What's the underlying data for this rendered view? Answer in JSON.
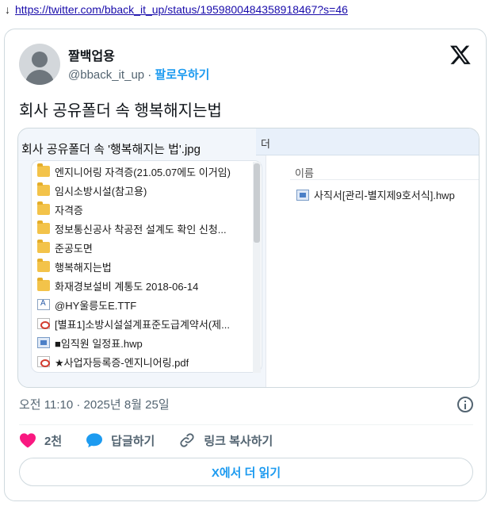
{
  "topbar": {
    "arrow": "↓",
    "url": "https://twitter.com/bback_it_up/status/1959800484358918467?s=46"
  },
  "author": {
    "display_name": "짤백업용",
    "handle": "@bback_it_up",
    "separator": "·",
    "follow_label": "팔로우하기"
  },
  "tweet": {
    "text": "회사 공유폴더 속 행복해지는법",
    "timestamp": "오전 11:10 · 2025년 8월 25일"
  },
  "media": {
    "title": "회사 공유폴더 속 '행복해지는 법'.jpg",
    "explorer_tab_fragment": "더",
    "column_header": "이름",
    "right_file": "사직서[관리-별지제9호서식].hwp",
    "files": [
      {
        "icon": "folder-icon",
        "name": "엔지니어링 자격증(21.05.07에도 이거임)"
      },
      {
        "icon": "folder-icon",
        "name": "임시소방시설(참고용)"
      },
      {
        "icon": "folder-icon",
        "name": "자격증"
      },
      {
        "icon": "folder-icon",
        "name": "정보통신공사 착공전 설계도 확인 신청..."
      },
      {
        "icon": "folder-icon",
        "name": "준공도면"
      },
      {
        "icon": "folder-icon",
        "name": "행복해지는법"
      },
      {
        "icon": "folder-icon",
        "name": "화재경보설비 계통도 2018-06-14"
      },
      {
        "icon": "font-file-icon",
        "name": "@HY울릉도E.TTF"
      },
      {
        "icon": "pdf-file-icon",
        "name": "[별표1]소방시설설계표준도급계약서(제..."
      },
      {
        "icon": "hwp-file-icon",
        "name": "■임직원 일정표.hwp"
      },
      {
        "icon": "pdf-file-icon",
        "name": "★사업자등록증-엔지니어링.pdf"
      }
    ]
  },
  "actions": {
    "like_count": "2천",
    "reply_label": "답글하기",
    "copy_link_label": "링크 복사하기"
  },
  "read_more_label": "X에서 더 읽기",
  "colors": {
    "accent": "#1d9bf0",
    "like": "#f91880",
    "text": "#0f1419",
    "muted": "#536471",
    "border": "#cfd9de"
  }
}
